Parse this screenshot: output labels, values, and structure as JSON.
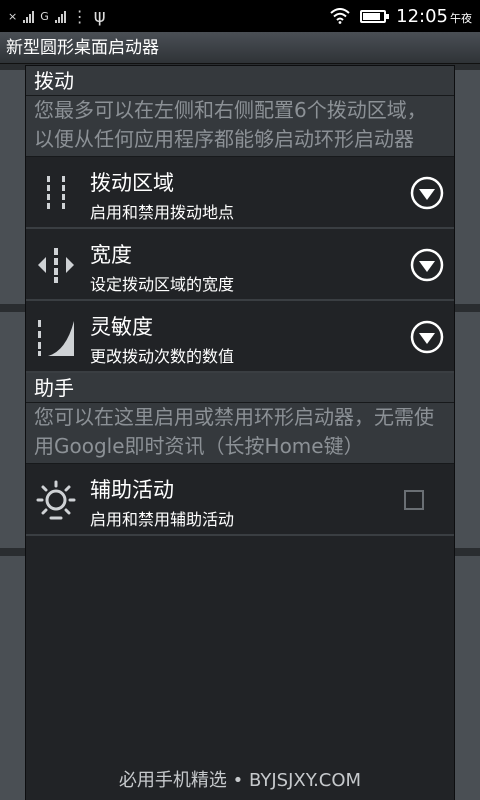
{
  "status_bar": {
    "sim1": "×",
    "sim2": "G",
    "time": "12:05",
    "period": "午夜",
    "battery_level": 0.85
  },
  "app_title": "新型圆形桌面启动器",
  "sections": [
    {
      "category": "拨动",
      "description": "您最多可以在左侧和右侧配置6个拨动区域，以便从任何应用程序都能够启动环形启动器",
      "items": [
        {
          "title": "拨动区域",
          "summary": "启用和禁用拨动地点",
          "icon": "swipe-zones-icon",
          "control": "dropdown"
        },
        {
          "title": "宽度",
          "summary": "设定拨动区域的宽度",
          "icon": "width-icon",
          "control": "dropdown"
        },
        {
          "title": "灵敏度",
          "summary": "更改拨动次数的数值",
          "icon": "sensitivity-icon",
          "control": "dropdown"
        }
      ]
    },
    {
      "category": "助手",
      "description": "您可以在这里启用或禁用环形启动器，无需使用Google即时资讯（长按Home键）",
      "items": [
        {
          "title": "辅助活动",
          "summary": "启用和禁用辅助活动",
          "icon": "assist-icon",
          "control": "checkbox",
          "checked": false
        }
      ]
    }
  ],
  "footer": "必用手机精选 • BYJSJXY.COM",
  "colors": {
    "panel": "#212326",
    "category_bg": "#35393d",
    "description_text": "#8c9196",
    "side_panels": "#4a4f54"
  }
}
